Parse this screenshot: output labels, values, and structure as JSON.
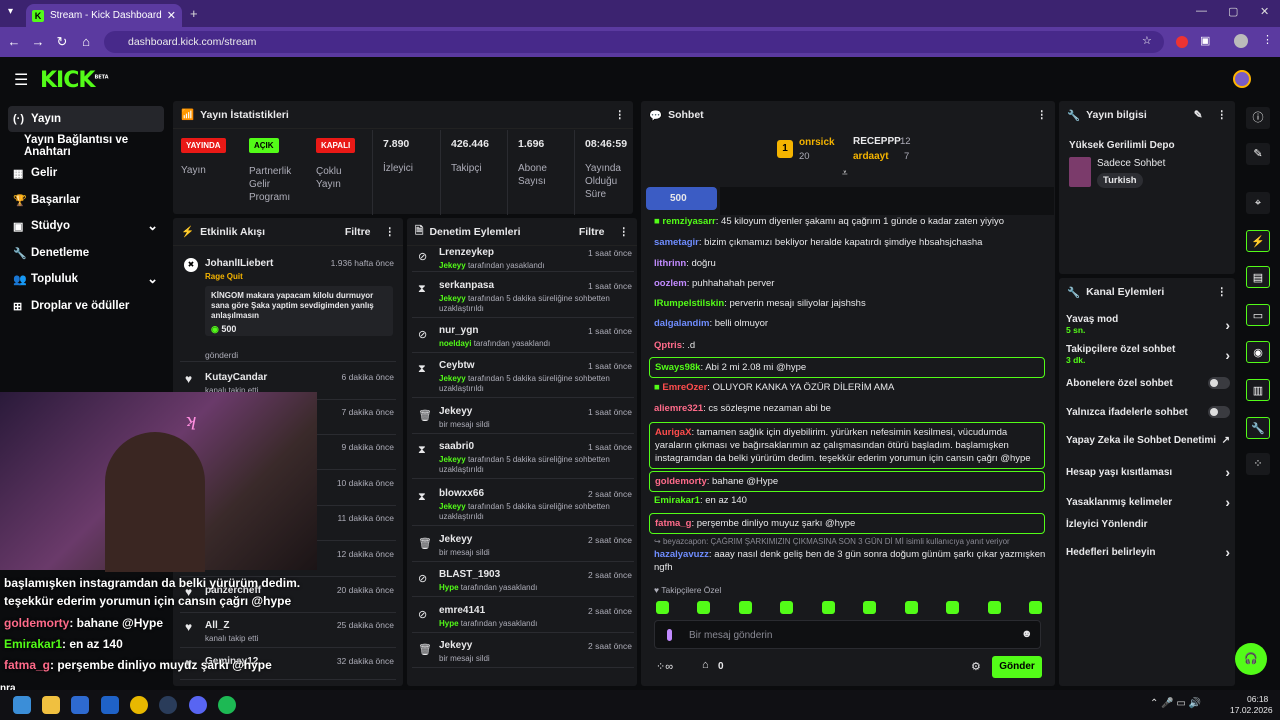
{
  "browser": {
    "tab_title": "Stream - Kick Dashboard",
    "url": "dashboard.kick.com/stream"
  },
  "header": {
    "logo": "KICK",
    "beta": "BETA"
  },
  "sidebar": {
    "items": [
      {
        "label": "Yayın",
        "icon": "stream-icon"
      },
      {
        "label": "Yayın Bağlantısı ve Anahtarı",
        "icon": ""
      },
      {
        "label": "Gelir",
        "icon": "revenue-icon"
      },
      {
        "label": "Başarılar",
        "icon": "trophy-icon"
      },
      {
        "label": "Stüdyo",
        "icon": "studio-icon"
      },
      {
        "label": "Denetleme",
        "icon": "wrench-icon"
      },
      {
        "label": "Topluluk",
        "icon": "community-icon"
      },
      {
        "label": "Droplar ve ödüller",
        "icon": "gift-icon"
      }
    ]
  },
  "stats": {
    "title": "Yayın İstatistikleri",
    "live_badge": "YAYINDA",
    "live_label": "Yayın",
    "partner_badge": "AÇIK",
    "partner_label": "Partnerlik Gelir Programı",
    "multi_badge": "KAPALI",
    "multi_label": "Çoklu Yayın",
    "viewers": "7.890",
    "viewers_label": "İzleyici",
    "followers": "426.446",
    "followers_label": "Takipçi",
    "subs": "1.696",
    "subs_label": "Abone Sayısı",
    "uptime": "08:46:59",
    "uptime_label": "Yayında Olduğu Süre"
  },
  "activity": {
    "title": "Etkinlik Akışı",
    "filter": "Filtre",
    "items": [
      {
        "name": "JohanlILiebert",
        "time": "1.936 hafta önce",
        "sub": "Rage Quit",
        "msg": "KİNGOM makara yapacam kilolu durmuyor sana göre Şaka yaptim sevdigimden yanlış anlaşılmasın",
        "amount": "500",
        "note": "gönderdi"
      },
      {
        "name": "KutayCandar",
        "time": "6 dakika önce",
        "sub": "kanalı takip etti"
      },
      {
        "time": "7 dakika önce"
      },
      {
        "time": "9 dakika önce"
      },
      {
        "time": "10 dakika önce"
      },
      {
        "time": "11 dakika önce"
      },
      {
        "time": "12 dakika önce"
      },
      {
        "name": "panzercheff",
        "time": "20 dakika önce",
        "sub": ""
      },
      {
        "name": "All_Z",
        "time": "25 dakika önce",
        "sub": "kanalı takip etti"
      },
      {
        "name": "Geminay12",
        "time": "32 dakika önce",
        "sub": ""
      }
    ]
  },
  "modlog": {
    "title": "Denetim Eylemleri",
    "filter": "Filtre",
    "items": [
      {
        "name": "Lrenzeykep",
        "time": "1 saat önce",
        "by": "Jekeyy",
        "text": "tarafından yasaklandı"
      },
      {
        "name": "serkanpasa",
        "time": "1 saat önce",
        "by": "Jekeyy",
        "text": "tarafından 5 dakika süreliğine sohbetten uzaklaştırıldı"
      },
      {
        "name": "nur_ygn",
        "time": "1 saat önce",
        "by": "noeldayi",
        "text": "tarafından yasaklandı"
      },
      {
        "name": "Ceybtw",
        "time": "1 saat önce",
        "by": "Jekeyy",
        "text": "tarafından 5 dakika süreliğine sohbetten uzaklaştırıldı"
      },
      {
        "name": "Jekeyy",
        "time": "1 saat önce",
        "by": "",
        "text": "bir mesajı sildi"
      },
      {
        "name": "saabri0",
        "time": "1 saat önce",
        "by": "Jekeyy",
        "text": "tarafından 5 dakika süreliğine sohbetten uzaklaştırıldı"
      },
      {
        "name": "blowxx66",
        "time": "2 saat önce",
        "by": "Jekeyy",
        "text": "tarafından 5 dakika süreliğine sohbetten uzaklaştırıldı"
      },
      {
        "name": "Jekeyy",
        "time": "2 saat önce",
        "by": "",
        "text": "bir mesajı sildi"
      },
      {
        "name": "BLAST_1903",
        "time": "2 saat önce",
        "by": "Hype",
        "text": "tarafından yasaklandı"
      },
      {
        "name": "emre4141",
        "time": "2 saat önce",
        "by": "Hype",
        "text": "tarafından yasaklandı"
      },
      {
        "name": "Jekeyy",
        "time": "2 saat önce",
        "by": "",
        "text": "bir mesajı sildi"
      }
    ]
  },
  "chat": {
    "title": "Sohbet",
    "top": [
      {
        "rank": "1",
        "name": "onrsick",
        "count": "20"
      },
      {
        "name": "RECEPPP",
        "count": "12"
      },
      {
        "name": "ardaayt",
        "count": "7"
      }
    ],
    "pinned_amount": "500",
    "messages": [
      {
        "user": "remziyasarr",
        "color": "#53fc18",
        "text": "45 kiloyum diyenler şakamı aq çağrım 1 günde o kadar zaten yiyiyo"
      },
      {
        "user": "sametagir",
        "color": "#6f8dff",
        "text": "bizim çıkmamızı bekliyor heralde kapatırdı şimdiye hbsahsjchasha"
      },
      {
        "user": "lithrinn",
        "color": "#c28bff",
        "text": "doğru"
      },
      {
        "user": "oozlem",
        "color": "#c28bff",
        "text": "puhhahahah perver"
      },
      {
        "user": "lRumpelstilskin",
        "color": "#53fc18",
        "text": "perverin mesajı siliyolar jajshshs"
      },
      {
        "user": "dalgalandim",
        "color": "#6f8dff",
        "text": "belli olmuyor"
      },
      {
        "user": "Qptris",
        "color": "#ff6b8a",
        "text": ".d"
      },
      {
        "user": "Sways98k",
        "color": "#53fc18",
        "text": "Abi 2 mi 2.08 mi @hype",
        "box": true
      },
      {
        "user": "EmreOzer",
        "color": "#ff4d4d",
        "text": "OLUYOR KANKA YA ÖZÜR DİLERİM AMA"
      },
      {
        "user": "aliemre321",
        "color": "#ff6b8a",
        "text": "cs sözleşme nezaman abi be"
      },
      {
        "user": "AurigaX",
        "color": "#ff4d4d",
        "text": "tamamen sağlık için diyebilirim. yürürken nefesimin kesilmesi, vücudumda yaraların çıkması ve bağırsaklarımın az çalışmasından ötürü başladım. başlamışken instagramdan da belki yürürüm dedim. teşekkür ederim yorumun için cansın çağrı @hype",
        "box": true
      },
      {
        "user": "goldemorty",
        "color": "#ff6b8a",
        "text": "bahane @Hype",
        "box": true
      },
      {
        "user": "Emirakar1",
        "color": "#53fc18",
        "text": "en az 140"
      },
      {
        "user": "fatma_g",
        "color": "#ff6b8a",
        "text": "perşembe dinliyo muyuz şarkı @hype",
        "box": true
      }
    ],
    "reply_note": "beyazcapon: ÇAĞRIM ŞARKIMIZIN ÇIKMASINA SON 3 GÜN Dİ Mİ isimli kullanıcıya yanıt veriyor",
    "reply_user": "hazalyavuzz",
    "reply_text": "aaay nasıl denk geliş ben de 3 gün sonra doğum günüm şarkı çıkar yazmışken ngfh",
    "followers_only": "Takipçilere Özel",
    "placeholder": "Bir mesaj gönderin",
    "send": "Gönder",
    "points": "0"
  },
  "info": {
    "title": "Yayın bilgisi",
    "stream_title": "Yüksek Gerilimli Depo",
    "category": "Sadece Sohbet",
    "tag": "Turkish"
  },
  "channel_actions": {
    "title": "Kanal Eylemleri",
    "items": [
      {
        "label": "Yavaş mod",
        "sub": "5 sn.",
        "type": "arrow"
      },
      {
        "label": "Takipçilere özel sohbet",
        "sub": "3 dk.",
        "type": "arrow"
      },
      {
        "label": "Abonelere özel sohbet",
        "sub": "",
        "type": "toggle"
      },
      {
        "label": "Yalnızca ifadelerle sohbet",
        "sub": "",
        "type": "toggle"
      },
      {
        "label": "Yapay Zeka ile Sohbet Denetimi",
        "sub": "",
        "type": "external"
      },
      {
        "label": "Hesap yaşı kısıtlaması",
        "sub": "",
        "type": "arrow"
      },
      {
        "label": "Yasaklanmış kelimeler",
        "sub": "",
        "type": "arrow"
      },
      {
        "label": "İzleyici Yönlendir",
        "sub": "",
        "type": "none"
      },
      {
        "label": "Hedefleri belirleyin",
        "sub": "",
        "type": "arrow"
      }
    ]
  },
  "overlay": {
    "lines": [
      "başlamışken instagramdan da belki yürürüm dedim.",
      "teşekkür ederim yorumun için cansın çağrı @hype"
    ],
    "chat": [
      {
        "user": "goldemorty",
        "text": ": bahane @Hype",
        "color": "#ff6b8a"
      },
      {
        "user": "Emirakar1",
        "text": ": en az 140",
        "color": "#53fc18"
      },
      {
        "user": "fatma_g",
        "text": ": perşembe dinliyo muyuz şarkı @hype",
        "color": "#ff6b8a"
      }
    ],
    "tail": "nra"
  },
  "taskbar": {
    "time": "06:18",
    "date": "17.02.2026"
  },
  "colors": {
    "accent": "#53fc18",
    "panel": "#18191c",
    "browser": "#5b3aa0"
  }
}
